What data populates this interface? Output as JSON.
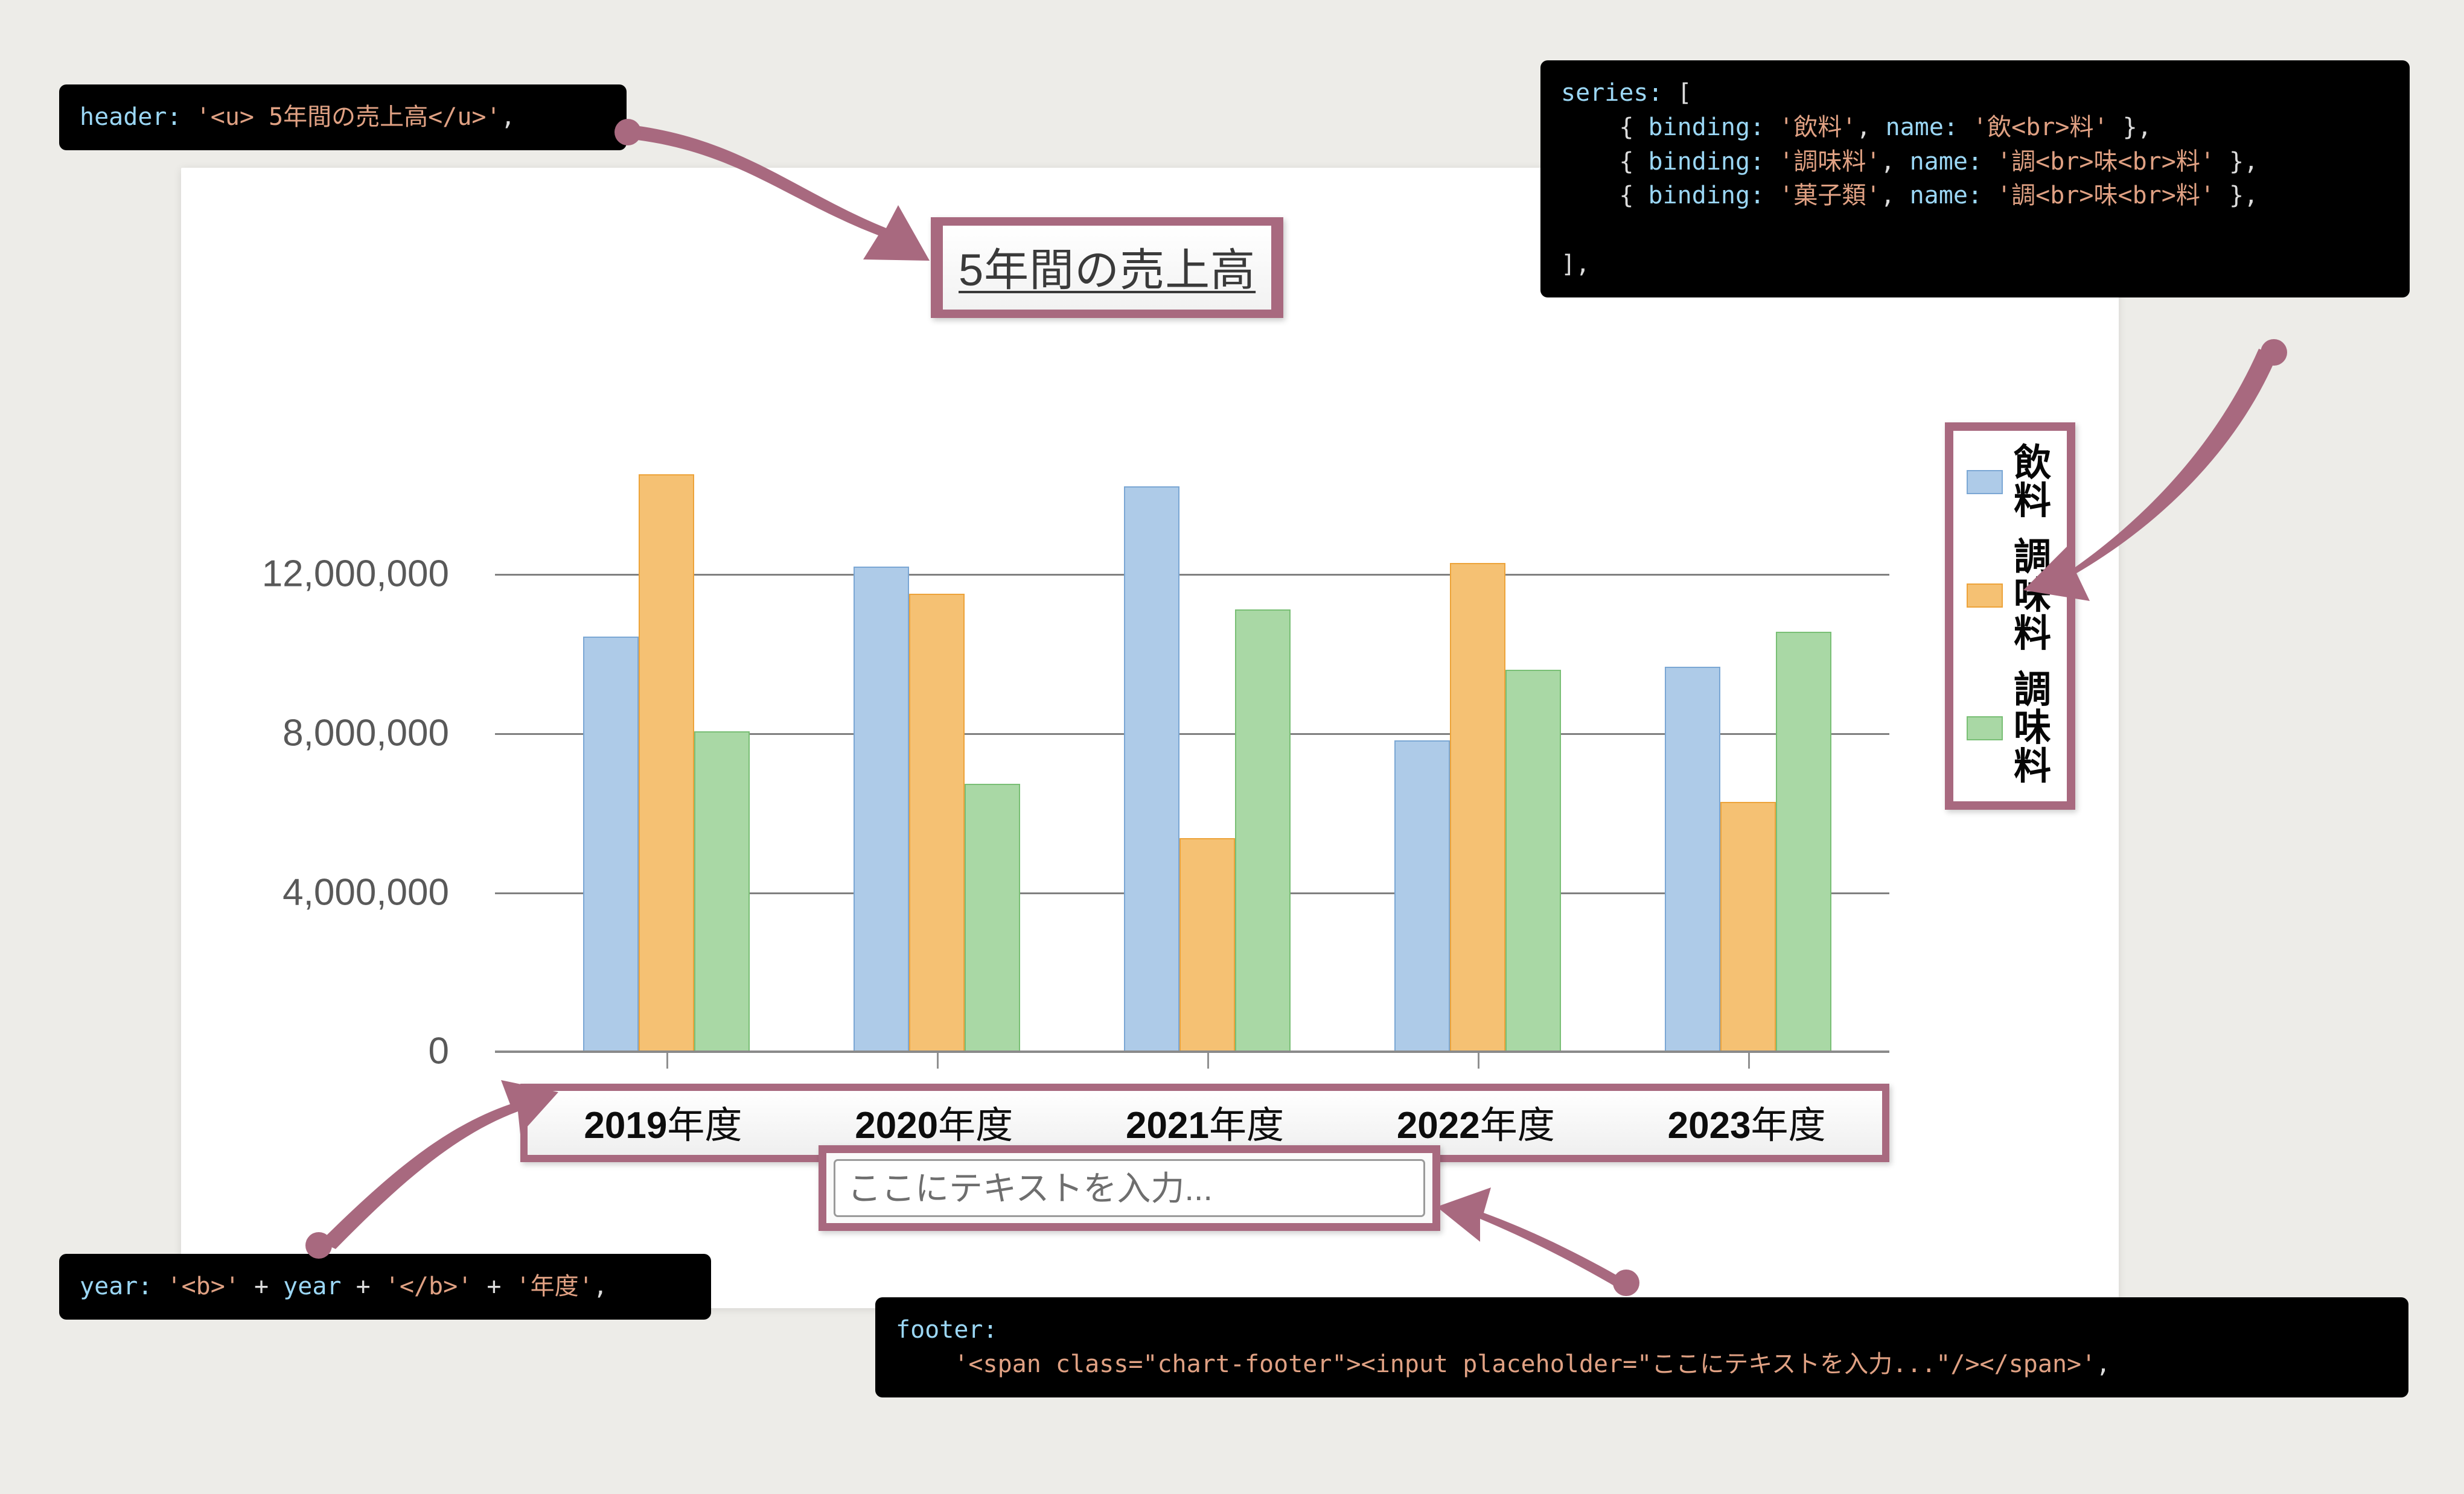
{
  "chart_data": {
    "type": "bar",
    "title": "5年間の売上高",
    "categories": [
      "2019年度",
      "2020年度",
      "2021年度",
      "2022年度",
      "2023年度"
    ],
    "series": [
      {
        "name": "飲料",
        "color": "#aecbe8",
        "values": [
          10470000,
          12240000,
          14260000,
          7870000,
          9720000
        ]
      },
      {
        "name": "調味料",
        "color": "#f5c173",
        "values": [
          14560000,
          11550000,
          5400000,
          12320000,
          6320000
        ]
      },
      {
        "name": "菓子類",
        "color": "#a9d8a5",
        "values": [
          8090000,
          6770000,
          11150000,
          9640000,
          10590000
        ]
      }
    ],
    "legend_labels": [
      "飲料",
      "調味料",
      "調味料"
    ],
    "ylim": [
      0,
      14800000
    ],
    "yticks": [
      0,
      4000000,
      8000000,
      12000000
    ],
    "ytick_labels": [
      "0",
      "4,000,000",
      "8,000,000",
      "12,000,000"
    ],
    "xlabel": "",
    "ylabel": "",
    "grid": true,
    "legend_position": "right"
  },
  "chart": {
    "title": "5年間の売上高",
    "x_labels": [
      {
        "year": "2019",
        "suffix": "年度"
      },
      {
        "year": "2020",
        "suffix": "年度"
      },
      {
        "year": "2021",
        "suffix": "年度"
      },
      {
        "year": "2022",
        "suffix": "年度"
      },
      {
        "year": "2023",
        "suffix": "年度"
      }
    ],
    "legend": [
      {
        "chars": [
          "飲",
          "料"
        ],
        "color": "#aecbe8"
      },
      {
        "chars": [
          "調",
          "味",
          "料"
        ],
        "color": "#f5c173"
      },
      {
        "chars": [
          "調",
          "味",
          "料"
        ],
        "color": "#a9d8a5"
      }
    ]
  },
  "footer": {
    "placeholder": "ここにテキストを入力..."
  },
  "code_header": {
    "key": "header:",
    "value": " '<u> 5年間の売上高</u>'",
    "tail": ","
  },
  "code_series": {
    "line1_key": "series:",
    "line1_rest": " [",
    "rows": [
      {
        "open": "    { ",
        "k1": "binding:",
        "v1": " '飲料'",
        "sep": ", ",
        "k2": "name:",
        "v2": " '飲<br>料'",
        "close": " },"
      },
      {
        "open": "    { ",
        "k1": "binding:",
        "v1": " '調味料'",
        "sep": ", ",
        "k2": "name:",
        "v2": " '調<br>味<br>料'",
        "close": " },"
      },
      {
        "open": "    { ",
        "k1": "binding:",
        "v1": " '菓子類'",
        "sep": ", ",
        "k2": "name:",
        "v2": " '調<br>味<br>料'",
        "close": " },"
      }
    ],
    "last": "],"
  },
  "code_year": {
    "key": "year:",
    "s1": " '<b>'",
    "op1": " + ",
    "var": "year",
    "op2": " + ",
    "s2": "'</b>'",
    "op3": " + ",
    "s3": "'年度'",
    "tail": ","
  },
  "code_footer": {
    "key": "footer:",
    "value": "    '<span class=\"chart-footer\"><input placeholder=\"ここにテキストを入力...\"/></span>'",
    "tail": ","
  },
  "colors": {
    "callout": "#a8697f",
    "code_bg": "#000000",
    "code_key": "#9bd7f5",
    "code_string": "#e0a183",
    "page_bg": "#edece8"
  }
}
